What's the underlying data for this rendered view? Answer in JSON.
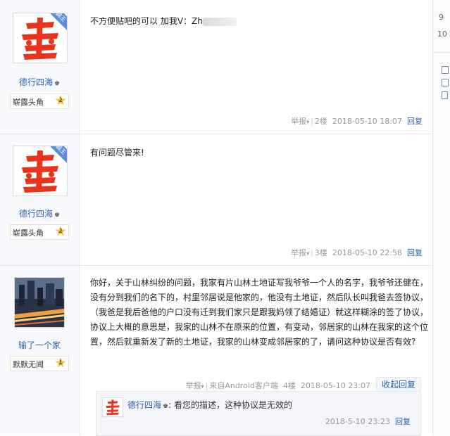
{
  "posts": [
    {
      "username": "德行四海",
      "badge_label": "霸王",
      "level_title": "崭露头角",
      "level": "2",
      "content": "不方便贴吧的可以 加我V：Zh",
      "tail": {
        "report": "举报",
        "floor": "2楼",
        "time": "2018-05-10 18:07",
        "reply": "回复"
      }
    },
    {
      "username": "德行四海",
      "badge_label": "霸王",
      "level_title": "崭露头角",
      "level": "2",
      "content": "有问题尽管来!",
      "tail": {
        "report": "举报",
        "floor": "3楼",
        "time": "2018-05-10 22:58",
        "reply": "回复"
      }
    },
    {
      "username": "输了一个家",
      "level_title": "默默无闻",
      "level": "1",
      "content_lines": [
        "你好，关于山林纠纷的问题，我家有片山林土地证写我爷爷一个人的名字，我爷爷还健在，",
        "没有分到我们的名下的，村里邻居说是他家的，他没有土地证，然后队长叫我爸去签协议，",
        "（我爸是我后爸他的户口没有迁到我们家只是跟我妈领了结婚证）就这样糊涂的签了协议，",
        "协议上大概的意思是，我家的山林不在原来的位置，有变动，邻居家的山林在我家的这个位",
        "置，然后就重新发了新的土地证，我家的山林变成邻居家的了，请问这种协议是否有效?"
      ],
      "tail": {
        "report": "举报",
        "source": "来自Android客户端",
        "floor": "4楼",
        "time": "2018-05-10 23:07",
        "collapse": "收起回复"
      }
    }
  ],
  "reply": {
    "username": "德行四海",
    "text": ": 看您的描述，这种协议是无效的",
    "time": "2018-5-10 23:23",
    "reply": "回复"
  },
  "sidebar": {
    "num1": "9",
    "num2": "10"
  },
  "colors": {
    "link": "#2d64b3",
    "logo_red": "#e8341c",
    "lz_blue": "#5a8fd8",
    "meta_gray": "#999999"
  }
}
